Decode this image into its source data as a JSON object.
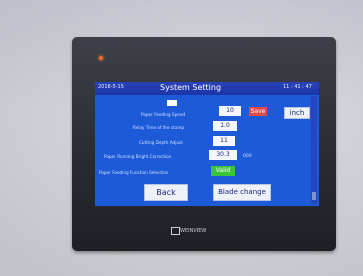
{
  "screen": {
    "date": "2018-5-15",
    "time": "11 : 41 : 47",
    "title": "System Setting",
    "unit_button": "inch",
    "save_label": "Save",
    "rows": [
      {
        "label": "Paper Feeding Speed",
        "value": "10"
      },
      {
        "label": "Relay Time of the stamp",
        "value": "1.0"
      },
      {
        "label": "Cutting Depth Adjust",
        "value": "11"
      },
      {
        "label": "Paper Running Bright Correction",
        "value": "30.3",
        "unit": "000"
      },
      {
        "label": "Paper Feeding Function Selection",
        "value": "Valid"
      }
    ],
    "back_button": "Back",
    "blade_change_button": "Blade change"
  },
  "device": {
    "brand": "WEINVIEW"
  }
}
